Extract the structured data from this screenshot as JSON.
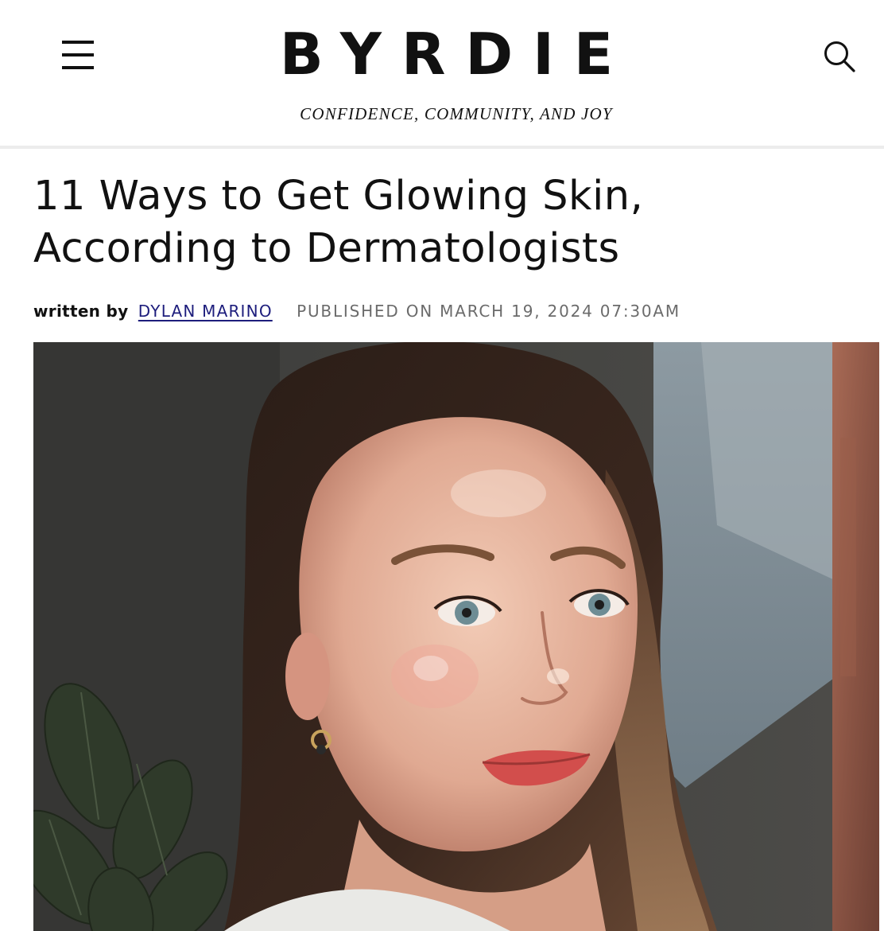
{
  "header": {
    "logo": "BYRDIE",
    "tagline": "CONFIDENCE, COMMUNITY, AND JOY",
    "menu_icon": "hamburger-menu-icon",
    "search_icon": "search-icon"
  },
  "article": {
    "title_line1": "11 Ways to Get Glowing Skin,",
    "title_line2": "According to Dermatologists",
    "byline_prefix": "written by",
    "author": "DYLAN MARINO",
    "published": "PUBLISHED ON MARCH 19, 2024 07:30AM"
  },
  "colors": {
    "text": "#111111",
    "author_link": "#1d1d7c",
    "published_gray": "#6b6b6b",
    "header_rule": "#ececec"
  }
}
